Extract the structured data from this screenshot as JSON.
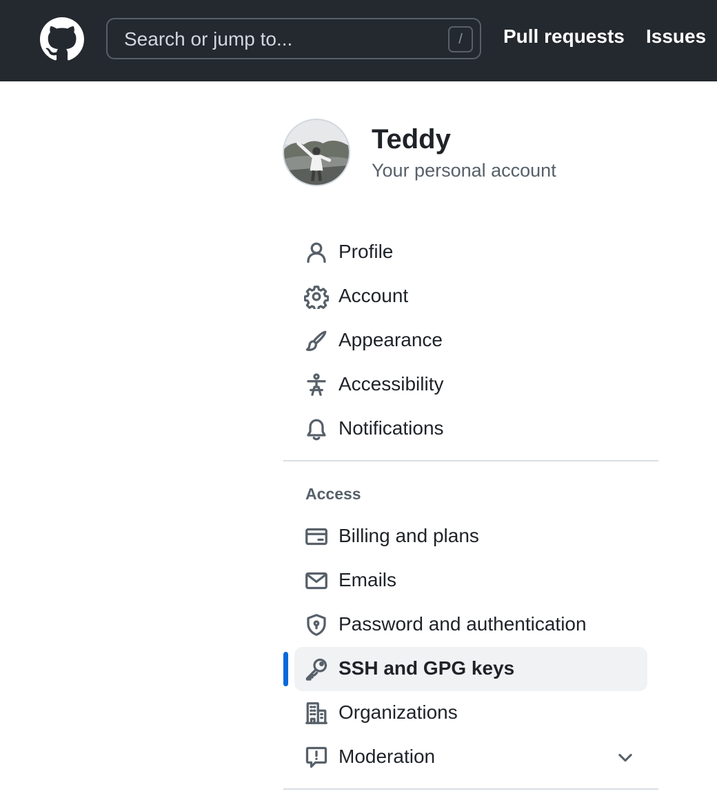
{
  "header": {
    "logo_icon": "github-mark-icon",
    "search_placeholder": "Search or jump to...",
    "search_shortcut": "/",
    "nav": [
      "Pull requests",
      "Issues"
    ]
  },
  "account": {
    "name": "Teddy",
    "subtitle": "Your personal account"
  },
  "menu": {
    "items": [
      {
        "label": "Profile",
        "icon": "person-icon"
      },
      {
        "label": "Account",
        "icon": "gear-icon"
      },
      {
        "label": "Appearance",
        "icon": "paintbrush-icon"
      },
      {
        "label": "Accessibility",
        "icon": "accessibility-icon"
      },
      {
        "label": "Notifications",
        "icon": "bell-icon"
      }
    ],
    "access_heading": "Access",
    "access_items": [
      {
        "label": "Billing and plans",
        "icon": "credit-card-icon"
      },
      {
        "label": "Emails",
        "icon": "mail-icon"
      },
      {
        "label": "Password and authentication",
        "icon": "shield-lock-icon"
      },
      {
        "label": "SSH and GPG keys",
        "icon": "key-icon",
        "selected": true
      },
      {
        "label": "Organizations",
        "icon": "organization-icon"
      },
      {
        "label": "Moderation",
        "icon": "report-icon",
        "expandable": true
      }
    ]
  },
  "colors": {
    "header_bg": "#24292f",
    "accent": "#0969da",
    "selected_bg": "#f0f2f4",
    "muted_text": "#57606a"
  }
}
